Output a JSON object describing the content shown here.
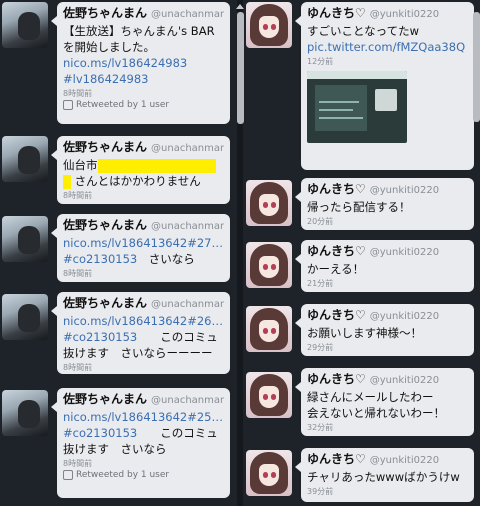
{
  "left_column": {
    "tweets": [
      {
        "name": "佐野ちゃんまん",
        "handle": "@unachanman",
        "text": "【生放送】ちゃんまん's BAR を開始しました。",
        "links": [
          "nico.ms/lv186424983",
          "#lv186424983"
        ],
        "time": "8時間前",
        "retweet": "Retweeted by 1 user"
      },
      {
        "name": "佐野ちゃんまん",
        "handle": "@unachanman",
        "text_line1": "仙台市",
        "text_line2": "さんとはかかわりません",
        "time": "8時間前"
      },
      {
        "name": "佐野ちゃんまん",
        "handle": "@unachanman",
        "link": "nico.ms/lv186413642#27…",
        "link2": "#co2130153",
        "text": "さいなら",
        "time": "8時間前"
      },
      {
        "name": "佐野ちゃんまん",
        "handle": "@unachanman",
        "link": "nico.ms/lv186413642#26…",
        "link2": "#co2130153",
        "text_a": "このコミュ",
        "text_b": "抜けます　さいならーーーー",
        "time": "8時間前"
      },
      {
        "name": "佐野ちゃんまん",
        "handle": "@unachanman",
        "link": "nico.ms/lv186413642#25…",
        "link2": "#co2130153",
        "text_a": "このコミュ",
        "text_b": "抜けます　さいなら",
        "time": "8時間前",
        "retweet": "Retweeted by 1 user"
      }
    ]
  },
  "right_column": {
    "tweets": [
      {
        "name": "ゆんきち♡",
        "handle": "@yunkiti0220",
        "text": "すごいことなってたw",
        "link": "pic.twitter.com/fMZQaa38Q",
        "time": "12分前"
      },
      {
        "name": "ゆんきち♡",
        "handle": "@yunkiti0220",
        "text": "帰ったら配信する！",
        "time": "20分前"
      },
      {
        "name": "ゆんきち♡",
        "handle": "@yunkiti0220",
        "text": "かーえる！",
        "time": "21分前"
      },
      {
        "name": "ゆんきち♡",
        "handle": "@yunkiti0220",
        "text": "お願いします神様〜！",
        "time": "29分前"
      },
      {
        "name": "ゆんきち♡",
        "handle": "@yunkiti0220",
        "text_line1": "緑さんにメールしたわー",
        "text_line2": "会えないと帰れないわー！",
        "time": "32分前"
      },
      {
        "name": "ゆんきち♡",
        "handle": "@yunkiti0220",
        "text": "チャリあったwwwばかうけw",
        "time": "39分前"
      }
    ]
  },
  "colors": {
    "background": "#1e2329",
    "bubble": "#e9ebee",
    "link": "#3b6fb1",
    "highlight": "#ffee00"
  }
}
